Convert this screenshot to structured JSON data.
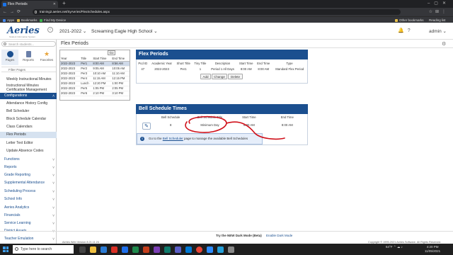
{
  "browser": {
    "tab_title": "Flex Periods",
    "url": "training2.aeries.net/SyAeries/FlexSchedules.aspx",
    "bookmarks": [
      "Apps",
      "Bookmarks",
      "Find My Device"
    ],
    "other_bookmarks": "Other bookmarks",
    "reading_list": "Reading list"
  },
  "header": {
    "logo": "Aeries",
    "logo_sub": "Student Information System",
    "year": "2021-2022",
    "school": "Screaming Eagle High School",
    "user": "admin"
  },
  "sidebar": {
    "search_placeholder": "Search students...",
    "quick_tabs": [
      "Pages",
      "Reports",
      "Favorites"
    ],
    "filter": "Filter Pages",
    "items": [
      "Weekly Instructional Minutes",
      "Instructional Minutes Certification Management",
      "Configurations",
      "Attendance History Config",
      "Bell Scheduler",
      "Block Schedule Calendar",
      "Class Calendars",
      "Flex Periods",
      "Letter Text Editor",
      "Update Absence Codes",
      "Functions",
      "Reports",
      "Grade Reporting",
      "Supplemental Attendance",
      "Scheduling Process",
      "School Info",
      "Aeries Analytics",
      "Financials",
      "Service Learning",
      "District Assets",
      "Teacher Emulation"
    ]
  },
  "content": {
    "title": "Flex Periods",
    "go_label": "Go",
    "period_table": {
      "headers": [
        "Year",
        "Title",
        "Start Time",
        "End Time"
      ],
      "rows": [
        [
          "2022-2023",
          "Per1",
          "8:00 AM",
          "8:56 AM"
        ],
        [
          "2022-2023",
          "Per2",
          "9:05 AM",
          "10:05 AM"
        ],
        [
          "2022-2023",
          "Per3",
          "10:10 AM",
          "11:10 AM"
        ],
        [
          "2022-2023",
          "Per4",
          "11:15 AM",
          "12:15 PM"
        ],
        [
          "2022-2023",
          "Lunch",
          "12:20 PM",
          "1:00 PM"
        ],
        [
          "2022-2023",
          "Per5",
          "1:05 PM",
          "2:05 PM"
        ],
        [
          "2022-2023",
          "Per6",
          "2:10 PM",
          "3:10 PM"
        ]
      ]
    },
    "flex_panel": {
      "title": "Flex Periods",
      "headers": [
        "Pcd ID",
        "Academic Year",
        "Short Title",
        "Tiny Title",
        "Description",
        "Start Time",
        "End Time",
        "Type"
      ],
      "row": [
        "47",
        "2022-2023",
        "Per1",
        "1",
        "Period 1 All Days",
        "8:00 AM",
        "8:00 AM",
        "Standard Flex Period"
      ],
      "buttons": [
        "Add",
        "Change",
        "Delete"
      ]
    },
    "bell_panel": {
      "title": "Bell Schedule Times",
      "headers": [
        "Bell Schedule",
        "Bell Schedule Title",
        "Start Time",
        "End Time"
      ],
      "row": [
        "8",
        "Minimum Day",
        "8:00 AM",
        "8:00 AM"
      ],
      "info_pre": "Go to the ",
      "info_link": "Bell Scheduler",
      "info_post": " page to manage the available Bell Schedules"
    }
  },
  "footer": {
    "version": "Aeries Web Version 8.21.11.24",
    "dark_mode": "Try the NEW Dark Mode (Beta)",
    "enable": "Enable Dark Mode",
    "copyright": "Copyright © 1995-2021 Aeries Software. All Rights Reserved."
  },
  "taskbar": {
    "search_placeholder": "Type here to search",
    "temp": "64°F",
    "time": "4:20 PM",
    "date": "11/05/2021"
  },
  "colors": {
    "brand": "#1b4f8f",
    "annotation": "#d0101a"
  }
}
